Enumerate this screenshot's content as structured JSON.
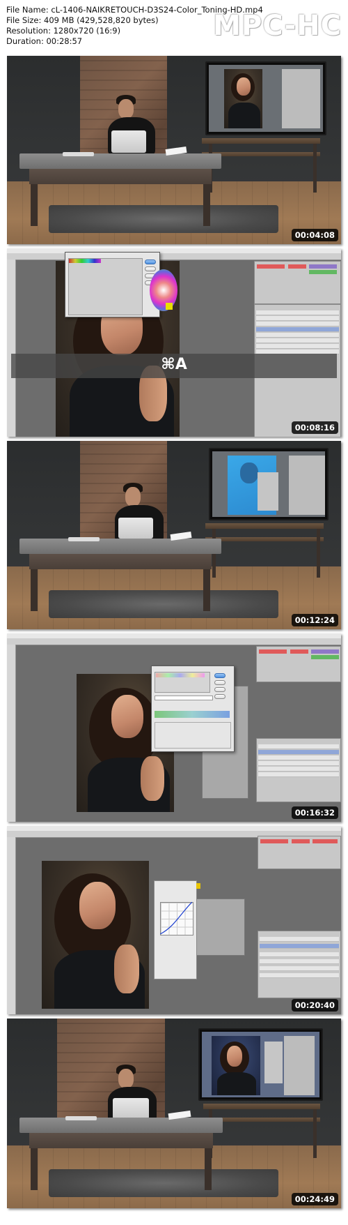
{
  "header": {
    "file_name": "File Name: cL-1406-NAIKRETOUCH-D3S24-Color_Toning-HD.mp4",
    "file_size": "File Size: 409 MB (429,528,820 bytes)",
    "resolution": "Resolution: 1280x720 (16:9)",
    "duration": "Duration: 00:28:57",
    "logo": "MPC-HC"
  },
  "thumbnails": [
    {
      "timestamp": "00:04:08",
      "scene": "studio"
    },
    {
      "timestamp": "00:08:16",
      "scene": "photoshop-gradient-dialog",
      "overlay": "⌘A"
    },
    {
      "timestamp": "00:12:24",
      "scene": "studio"
    },
    {
      "timestamp": "00:16:32",
      "scene": "photoshop-gradient-editor"
    },
    {
      "timestamp": "00:20:40",
      "scene": "photoshop-curves"
    },
    {
      "timestamp": "00:24:49",
      "scene": "studio"
    }
  ]
}
